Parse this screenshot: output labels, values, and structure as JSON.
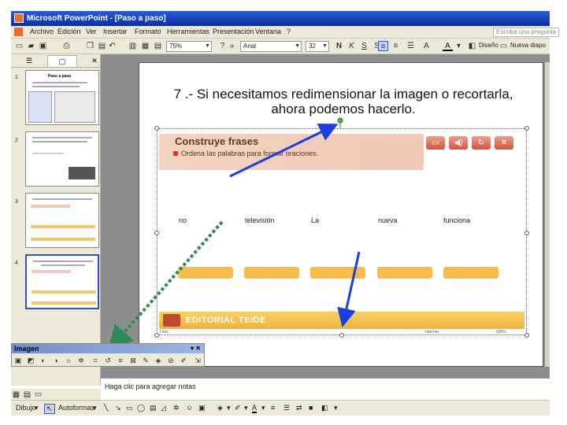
{
  "window": {
    "title": "Microsoft PowerPoint - [Paso a paso]"
  },
  "menu": {
    "items": [
      "Archivo",
      "Edición",
      "Ver",
      "Insertar",
      "Formato",
      "Herramientas",
      "Presentación",
      "Ventana",
      "?"
    ],
    "help_placeholder": "Escriba una pregunta"
  },
  "toolbar": {
    "zoom": "75%",
    "font": "Arial",
    "font_size": "32",
    "bold": "N",
    "italic": "K",
    "underline": "S",
    "design_label": "Diseño",
    "new_slide_label": "Nueva diapo"
  },
  "left_panel": {
    "tab_outline": "Esquema",
    "tab_slides": "Diapositivas",
    "slide_numbers": [
      "1",
      "2",
      "3",
      "4"
    ],
    "thumb1_title": "Paso a paso"
  },
  "slide": {
    "title_line1": "7 .- Si necesitamos redimensionar la imagen o recortarla,",
    "title_line2": "ahora podemos hacerlo."
  },
  "embedded": {
    "banner_title": "Construye frases",
    "banner_subtitle": "Ordena las palabras para formar oraciones.",
    "words": [
      "no",
      "televisión",
      "La",
      "nueva",
      "funciona"
    ],
    "footer_text": "EDITORIAL TEIDE",
    "status_left": "Listo",
    "status_mid": "Internet",
    "status_right": "100%"
  },
  "image_toolbar": {
    "title": "Imagen"
  },
  "notes": {
    "placeholder": "Haga clic para agregar notas"
  },
  "drawing_toolbar": {
    "draw_label": "Dibujo",
    "autoshapes_label": "Autoformas"
  },
  "colors": {
    "titlebar": "#1640b8",
    "arrow_blue": "#1a3ee0",
    "arrow_green": "#2e8b57",
    "banner": "#f3d2c0",
    "slot": "#f7bd48",
    "footer": "#eeb538"
  }
}
